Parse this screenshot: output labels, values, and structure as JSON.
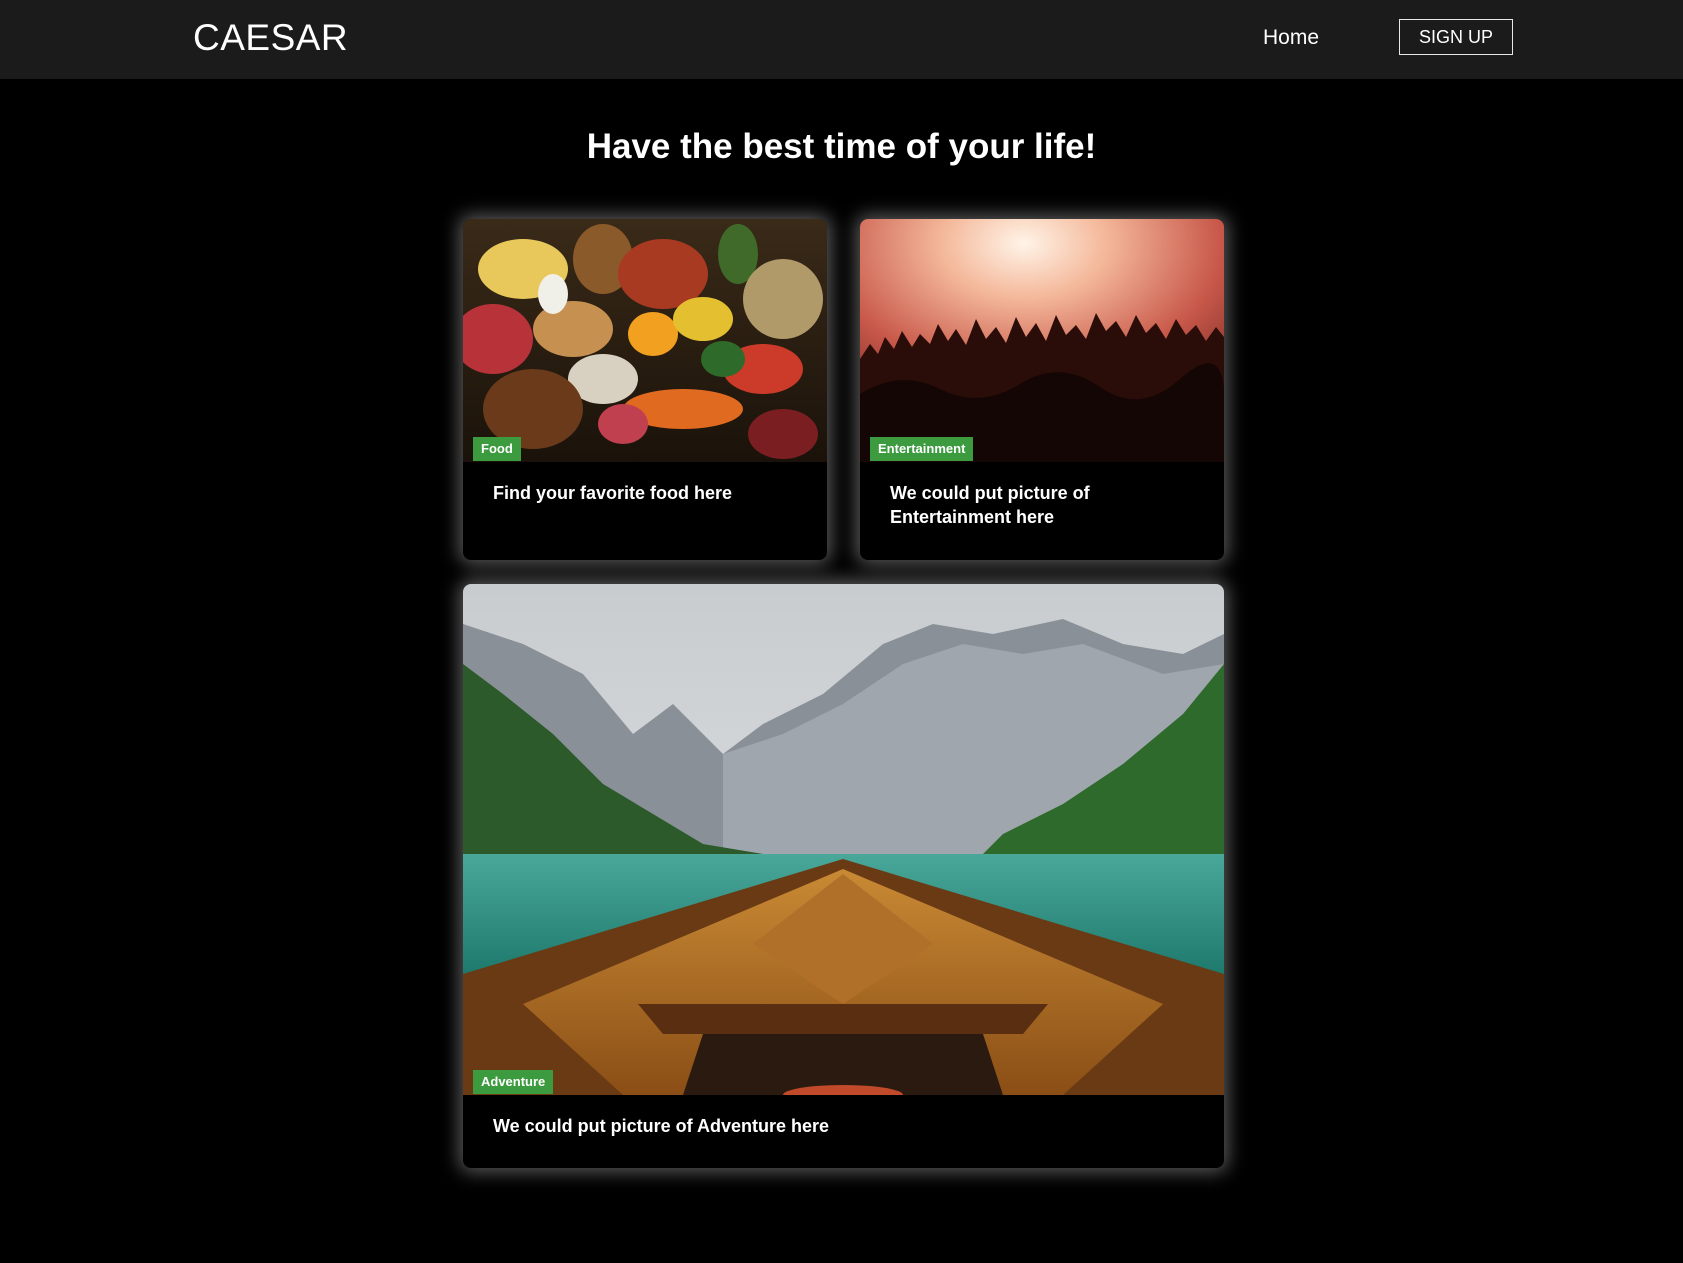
{
  "nav": {
    "brand": "CAESAR",
    "home_label": "Home",
    "signup_label": "SIGN UP"
  },
  "hero": {
    "headline": "Have the best time of your life!"
  },
  "cards": [
    {
      "tag": "Food",
      "text": "Find your favorite food here"
    },
    {
      "tag": "Entertainment",
      "text": "We could put picture of Entertainment here"
    },
    {
      "tag": "Adventure",
      "text": "We could put picture of Adventure here"
    }
  ],
  "colors": {
    "navbar_bg": "#1b1b1b",
    "page_bg": "#000000",
    "tag_green": "#3c9a3f"
  }
}
